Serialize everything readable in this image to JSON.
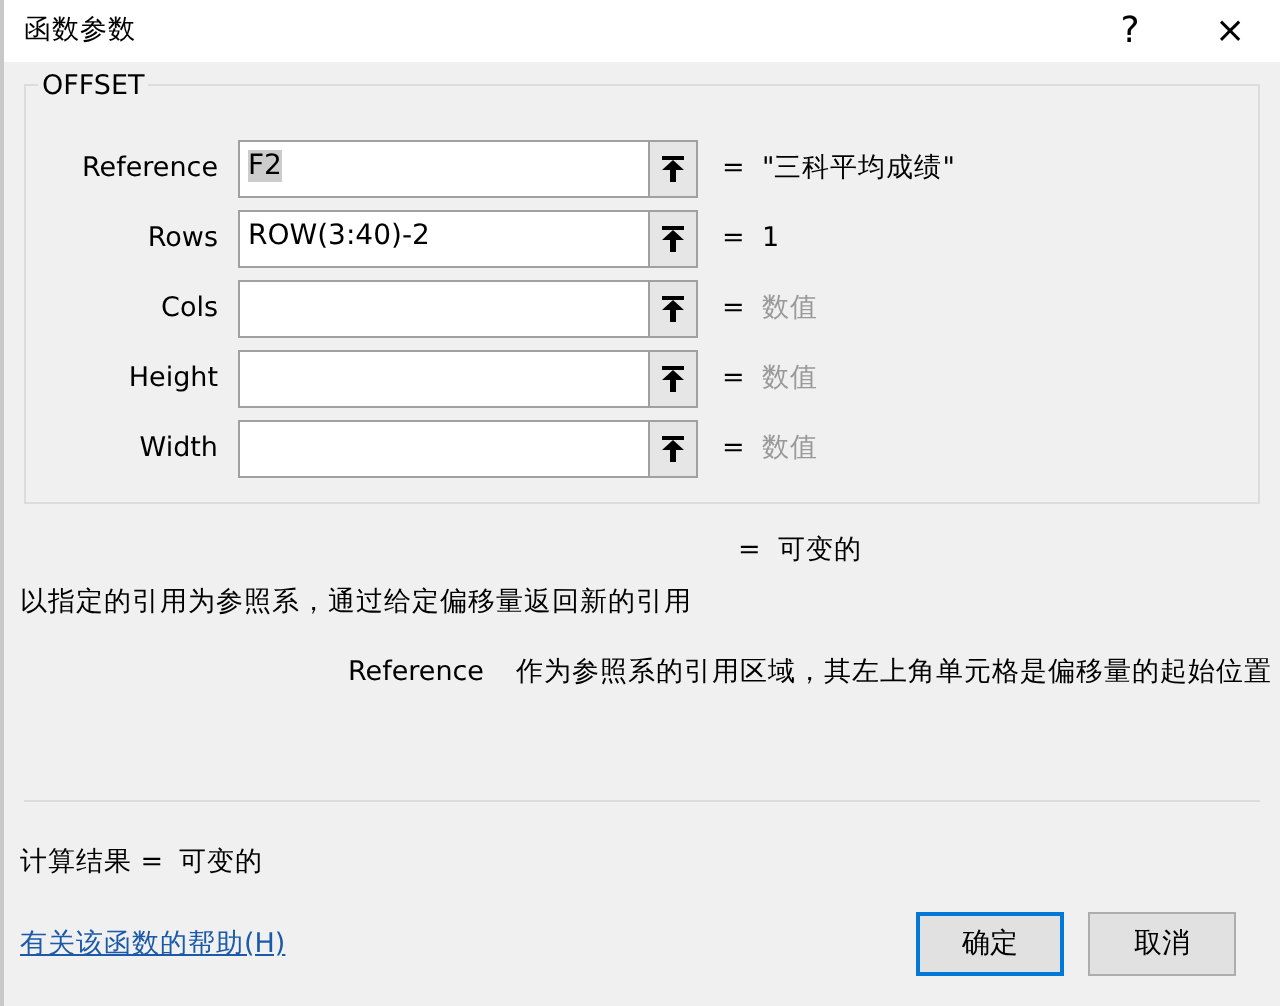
{
  "window": {
    "title": "函数参数",
    "help_button": "?",
    "close_button": "×"
  },
  "function_name": "OFFSET",
  "arguments": [
    {
      "label": "Reference",
      "value": "F2",
      "value_selected": true,
      "equals": "=",
      "result": "\"三科平均成绩\"",
      "result_muted": false
    },
    {
      "label": "Rows",
      "value": "ROW(3:40)-2",
      "value_selected": false,
      "equals": "=",
      "result": "1",
      "result_muted": false
    },
    {
      "label": "Cols",
      "equals": "=",
      "result": "数值",
      "result_muted": true
    },
    {
      "label": "Height",
      "equals": "=",
      "result": "数值",
      "result_muted": true
    },
    {
      "label": "Width",
      "equals": "=",
      "result": "数值",
      "result_muted": true
    }
  ],
  "overall": {
    "equals": "=",
    "result": "可变的"
  },
  "description": "以指定的引用为参照系，通过给定偏移量返回新的引用",
  "argument_help": {
    "name": "Reference",
    "text": "作为参照系的引用区域，其左上角单元格是偏移量的起始位置"
  },
  "formula_result": {
    "label": "计算结果 =",
    "value": "可变的"
  },
  "help_link": "有关该函数的帮助(H)",
  "buttons": [
    {
      "label": "确定",
      "default": true
    },
    {
      "label": "取消",
      "default": false
    }
  ]
}
